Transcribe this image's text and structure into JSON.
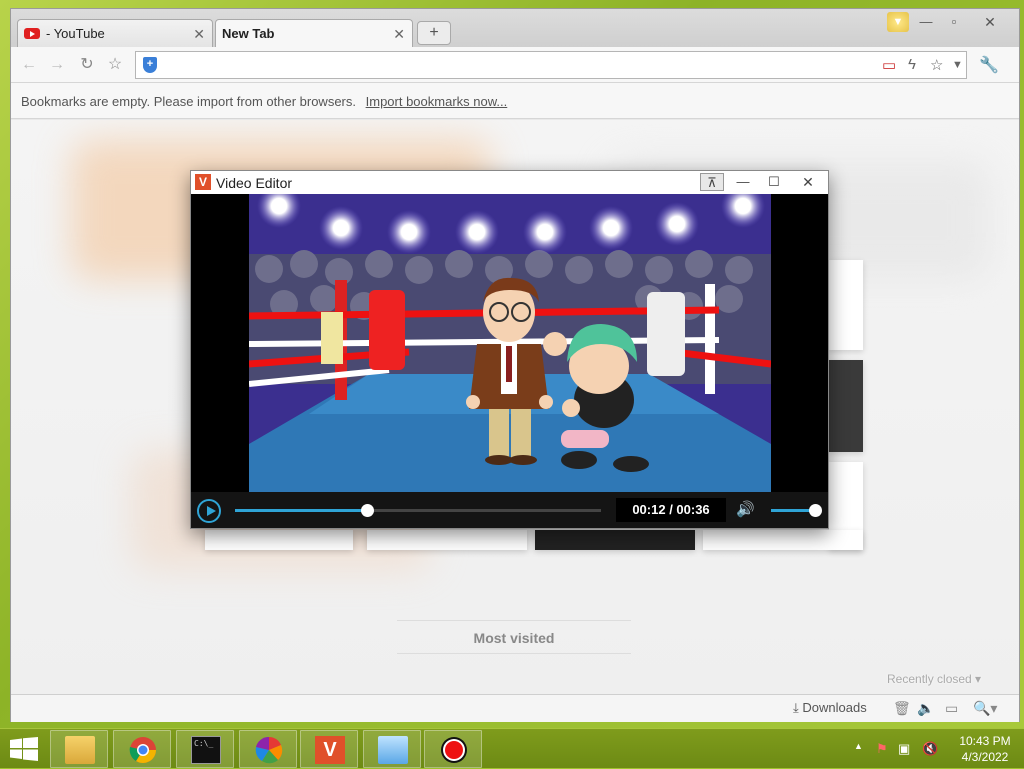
{
  "browser": {
    "tabs": [
      {
        "label": "- YouTube",
        "icon": "youtube-icon"
      },
      {
        "label": "New Tab",
        "active": true
      }
    ],
    "new_tab_symbol": "+",
    "bookmarks_bar": {
      "message": "Bookmarks are empty. Please import from other browsers.",
      "link": "Import bookmarks now..."
    },
    "most_visited": "Most visited",
    "recently_closed": "Recently closed",
    "downloads": "Downloads"
  },
  "video_editor": {
    "title": "Video Editor",
    "logo_letter": "V",
    "time_display": "00:12 / 00:36",
    "progress_fraction": 0.36,
    "volume_fraction": 1.0
  },
  "taskbar": {
    "apps": [
      "file-explorer",
      "chrome",
      "command-prompt",
      "photos-pinwheel",
      "video-editor",
      "control-panel",
      "recorder"
    ],
    "clock_time": "10:43 PM",
    "clock_date": "4/3/2022"
  },
  "colors": {
    "accent": "#2fa4d6",
    "desktop": "#8db327",
    "taskbar": "#6d8a14"
  }
}
